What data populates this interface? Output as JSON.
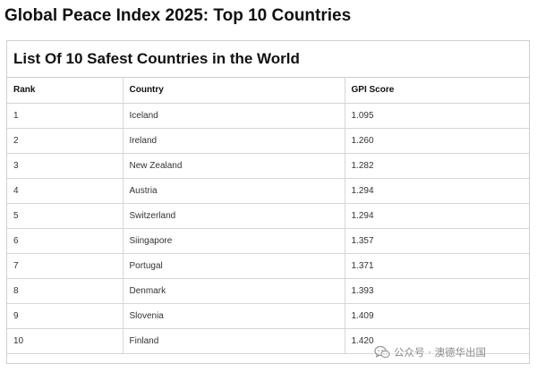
{
  "page": {
    "title": "Global Peace Index 2025: Top 10 Countries"
  },
  "table": {
    "caption": "List Of 10 Safest Countries in the World",
    "headers": [
      "Rank",
      "Country",
      "GPI Score"
    ],
    "rows": [
      [
        "1",
        "Iceland",
        "1.095"
      ],
      [
        "2",
        "Ireland",
        "1.260"
      ],
      [
        "3",
        "New Zealand",
        "1.282"
      ],
      [
        "4",
        "Austria",
        "1.294"
      ],
      [
        "5",
        "Switzerland",
        "1.294"
      ],
      [
        "6",
        "Siingapore",
        "1.357"
      ],
      [
        "7",
        "Portugal",
        "1.371"
      ],
      [
        "8",
        "Denmark",
        "1.393"
      ],
      [
        "9",
        "Slovenia",
        "1.409"
      ],
      [
        "10",
        "Finland",
        "1.420"
      ]
    ]
  },
  "watermark": {
    "icon": "wechat-icon",
    "text": "公众号 · 澳德华出国"
  }
}
